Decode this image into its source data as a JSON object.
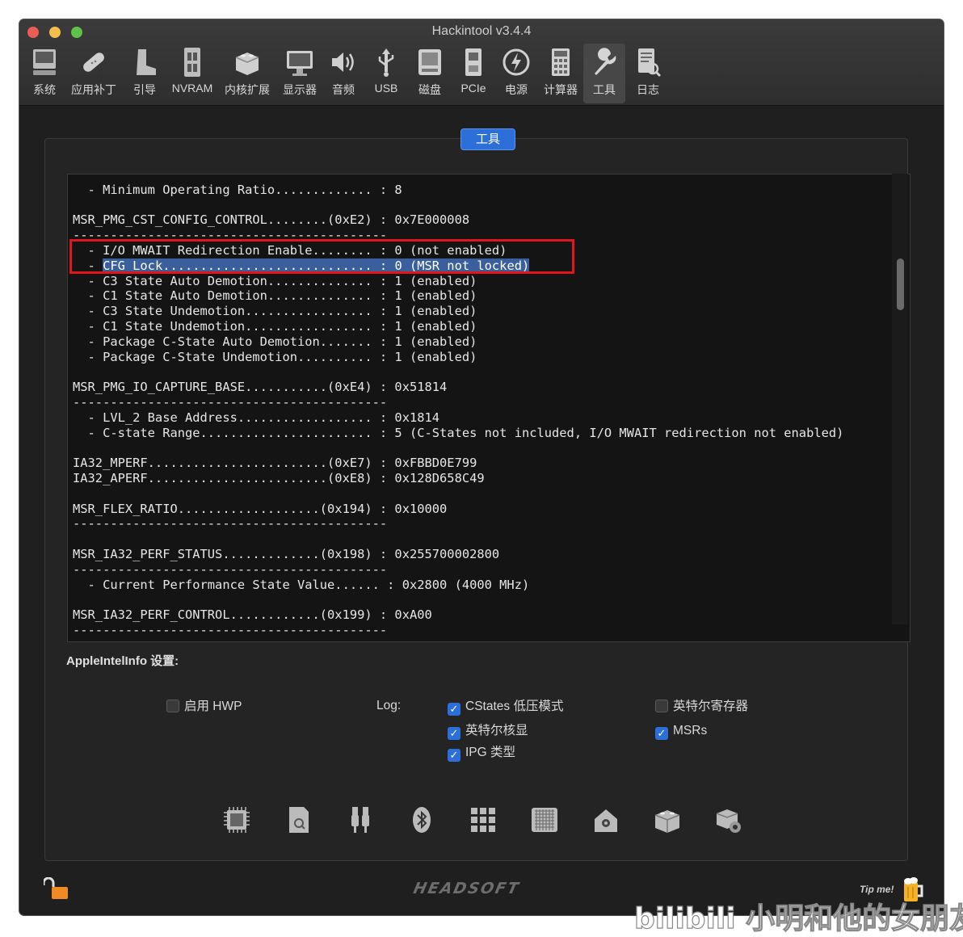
{
  "window": {
    "title": "Hackintool v3.4.4"
  },
  "toolbar": [
    {
      "label": "系统",
      "icon": "monitor-system-icon"
    },
    {
      "label": "应用补丁",
      "icon": "bandage-icon"
    },
    {
      "label": "引导",
      "icon": "boot-icon"
    },
    {
      "label": "NVRAM",
      "icon": "memory-chip-icon"
    },
    {
      "label": "内核扩展",
      "icon": "lego-brick-icon"
    },
    {
      "label": "显示器",
      "icon": "display-icon"
    },
    {
      "label": "音频",
      "icon": "speaker-icon"
    },
    {
      "label": "USB",
      "icon": "usb-icon"
    },
    {
      "label": "磁盘",
      "icon": "disk-icon"
    },
    {
      "label": "PCIe",
      "icon": "pcie-card-icon"
    },
    {
      "label": "电源",
      "icon": "power-icon"
    },
    {
      "label": "计算器",
      "icon": "calculator-icon"
    },
    {
      "label": "工具",
      "icon": "wrench-icon"
    },
    {
      "label": "日志",
      "icon": "log-document-icon"
    }
  ],
  "tab": {
    "title": "工具"
  },
  "console": {
    "lines": [
      "",
      "  - Minimum Operating Ratio............. : 8",
      "",
      "MSR_PMG_CST_CONFIG_CONTROL........(0xE2) : 0x7E000008",
      "------------------------------------------",
      "  - I/O MWAIT Redirection Enable........ : 0 (not enabled)",
      "  - ",
      "  - C3 State Auto Demotion.............. : 1 (enabled)",
      "  - C1 State Auto Demotion.............. : 1 (enabled)",
      "  - C3 State Undemotion................. : 1 (enabled)",
      "  - C1 State Undemotion................. : 1 (enabled)",
      "  - Package C-State Auto Demotion....... : 1 (enabled)",
      "  - Package C-State Undemotion.......... : 1 (enabled)",
      "",
      "MSR_PMG_IO_CAPTURE_BASE...........(0xE4) : 0x51814",
      "------------------------------------------",
      "  - LVL_2 Base Address.................. : 0x1814",
      "  - C-state Range....................... : 5 (C-States not included, I/O MWAIT redirection not enabled)",
      "",
      "IA32_MPERF........................(0xE7) : 0xFBBD0E799",
      "IA32_APERF........................(0xE8) : 0x128D658C49",
      "",
      "MSR_FLEX_RATIO...................(0x194) : 0x10000",
      "------------------------------------------",
      "",
      "MSR_IA32_PERF_STATUS.............(0x198) : 0x255700002800",
      "------------------------------------------",
      "  - Current Performance State Value...... : 0x2800 (4000 MHz)",
      "",
      "MSR_IA32_PERF_CONTROL............(0x199) : 0xA00",
      "------------------------------------------"
    ],
    "highlighted": "CFG Lock............................ : 0 (MSR not locked)"
  },
  "settings": {
    "title": "AppleIntelInfo 设置:",
    "enable_hwp": {
      "label": "启用 HWP",
      "checked": false
    },
    "log_label": "Log:",
    "cstates": {
      "label": "CStates 低压模式",
      "checked": true
    },
    "intel_gpu": {
      "label": "英特尔核显",
      "checked": true
    },
    "ipg_type": {
      "label": "IPG 类型",
      "checked": true
    },
    "intel_registers": {
      "label": "英特尔寄存器",
      "checked": false
    },
    "msrs": {
      "label": "MSRs",
      "checked": true
    }
  },
  "bottom_tools": [
    "cpu-chip-icon",
    "sd-card-search-icon",
    "usb-plugs-icon",
    "bluetooth-icon",
    "grid-apps-icon",
    "memory-grid-icon",
    "home-icon",
    "kext-brick-icon",
    "kext-brick-gear-icon"
  ],
  "footer": {
    "brand": "HEADSOFT",
    "tip": "Tip me!",
    "watermark": "bilibili 小明和他的女朋友"
  },
  "colors": {
    "accent": "#2c6fd8",
    "highlight": "#3b5f9c",
    "callout": "#e0161c"
  }
}
